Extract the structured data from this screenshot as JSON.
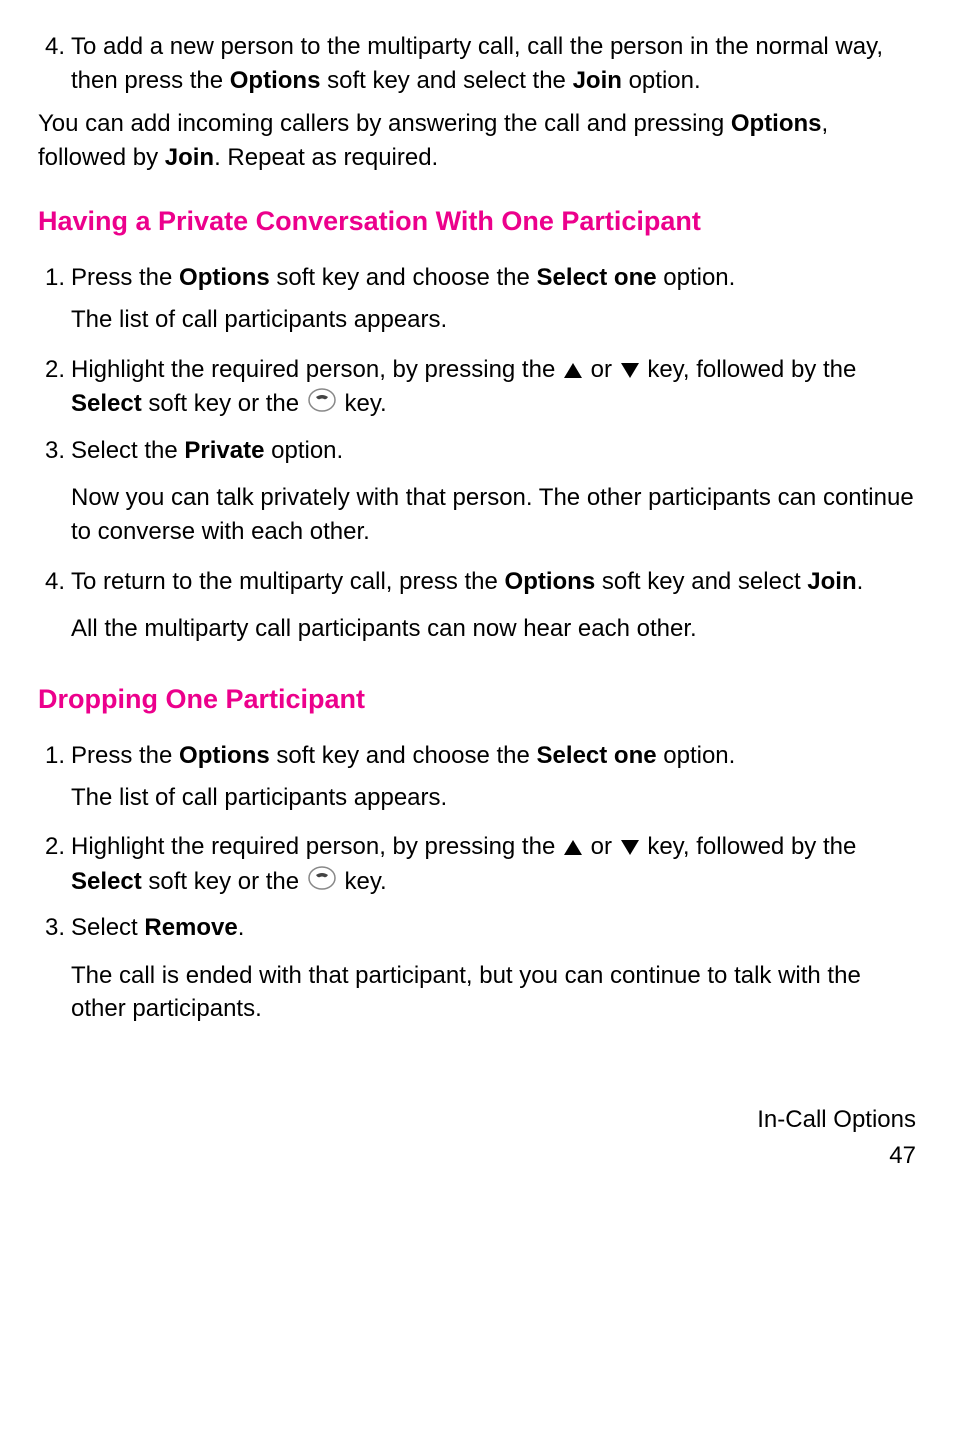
{
  "items": {
    "item4_number": "4.",
    "item4_text_1": "To add a new person to the multiparty call, call the person in the normal way, then press the ",
    "item4_bold_1": "Options",
    "item4_text_2": " soft key and select the ",
    "item4_bold_2": "Join",
    "item4_text_3": " option."
  },
  "paragraph1": {
    "text_1": "You can add incoming callers by answering the call and pressing ",
    "bold_1": "Options",
    "text_2": ", followed by ",
    "bold_2": "Join",
    "text_3": ". Repeat as required."
  },
  "heading1": "Having a Private Conversation With One Participant",
  "section1": {
    "item1_number": "1.",
    "item1_text_1": "Press the ",
    "item1_bold_1": "Options",
    "item1_text_2": " soft key and choose the ",
    "item1_bold_2": "Select one",
    "item1_text_3": " option.",
    "item1_sub": "The list of call participants appears.",
    "item2_number": "2.",
    "item2_text_1": "Highlight the required person, by pressing the ",
    "item2_text_2": " or ",
    "item2_text_3": " key, followed by the ",
    "item2_bold_1": "Select",
    "item2_text_4": " soft key or the ",
    "item2_text_5": " key.",
    "item3_number": "3.",
    "item3_text_1": "Select the ",
    "item3_bold_1": "Private",
    "item3_text_2": " option.",
    "item3_sub": "Now you can talk privately with that person. The other participants can continue to converse with each other.",
    "item4_number": "4.",
    "item4_text_1": "To return to the multiparty call, press the ",
    "item4_bold_1": "Options",
    "item4_text_2": " soft key and select ",
    "item4_bold_2": "Join",
    "item4_text_3": ".",
    "item4_sub": "All the multiparty call participants can now hear each other."
  },
  "heading2": "Dropping One Participant",
  "section2": {
    "item1_number": "1.",
    "item1_text_1": "Press the ",
    "item1_bold_1": "Options",
    "item1_text_2": " soft key and choose the ",
    "item1_bold_2": "Select one",
    "item1_text_3": " option.",
    "item1_sub": "The list of call participants appears.",
    "item2_number": "2.",
    "item2_text_1": "Highlight the required person, by pressing the ",
    "item2_text_2": " or ",
    "item2_text_3": " key, followed by the ",
    "item2_bold_1": "Select",
    "item2_text_4": " soft key or the ",
    "item2_text_5": " key.",
    "item3_number": "3.",
    "item3_text_1": "Select ",
    "item3_bold_1": "Remove",
    "item3_text_2": ".",
    "item3_sub": "The call is ended with that participant, but you can continue to talk with the other participants."
  },
  "footer": {
    "title": "In-Call Options",
    "page": "47"
  }
}
